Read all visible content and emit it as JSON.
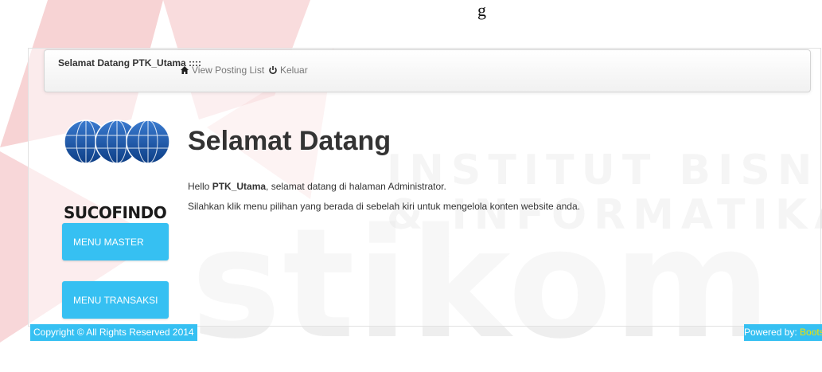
{
  "watermark": {
    "line1": "INSTITUT BISNIS",
    "line2": "& INFORMATIKA",
    "big": "stikom",
    "top_fragment": "g"
  },
  "navbar": {
    "brand": "Selamat Datang PTK_Utama ::::",
    "links": [
      {
        "label": "View Posting List",
        "icon": "home-icon"
      },
      {
        "label": "Keluar",
        "icon": "power-icon"
      }
    ]
  },
  "sidebar": {
    "logo_text": "SUCOFINDO",
    "menu": [
      {
        "label": "MENU MASTER"
      },
      {
        "label": "MENU TRANSAKSI"
      }
    ]
  },
  "main": {
    "title": "Selamat Datang",
    "greeting_prefix": "Hello ",
    "username": "PTK_Utama",
    "greeting_suffix": ", selamat datang di halaman Administrator.",
    "instruction": "Silahkan klik menu pilihan yang berada di sebelah kiri untuk mengelola konten website anda."
  },
  "footer": {
    "copyright": "Copyright © All Rights Reserved 2014",
    "powered_prefix": "Powered by: ",
    "powered_brand": "Bootstrap"
  },
  "colors": {
    "accent": "#36c0f2",
    "watermark_red": "#d9242a",
    "logo_blue": "#1f5fa8"
  }
}
